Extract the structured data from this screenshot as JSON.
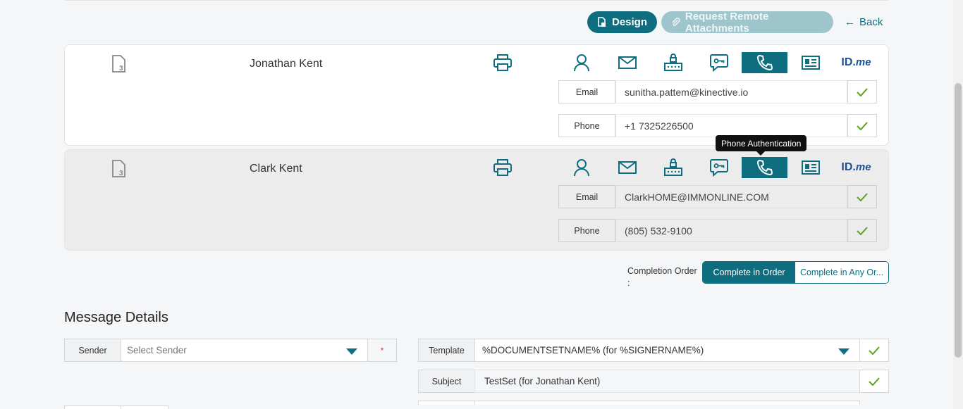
{
  "toolbar": {
    "design_label": "Design",
    "remote_label": "Request Remote Attachments",
    "back_label": "Back"
  },
  "signers": [
    {
      "name": "Jonathan Kent",
      "email_label": "Email",
      "email": "sunitha.pattem@kinective.io",
      "phone_label": "Phone",
      "phone": "+1 7325226500"
    },
    {
      "name": "Clark Kent",
      "email_label": "Email",
      "email": "ClarkHOME@IMMONLINE.COM",
      "phone_label": "Phone",
      "phone": "(805) 532-9100"
    }
  ],
  "auth_icons": [
    "person-icon",
    "mail-icon",
    "router-icon",
    "chat-key-icon",
    "phone-icon",
    "id-card-icon",
    "idme-logo"
  ],
  "idme": {
    "id": "ID.",
    "me": "me"
  },
  "tooltip": "Phone Authentication",
  "completion": {
    "label": "Completion Order :",
    "option_in_order": "Complete in Order",
    "option_any_order": "Complete in Any Or..."
  },
  "message": {
    "title": "Message Details",
    "sender_label": "Sender",
    "sender_placeholder": "Select Sender",
    "required_mark": "*",
    "template_label": "Template",
    "template_value": "%DOCUMENTSETNAME% (for %SIGNERNAME%)",
    "subject_label": "Subject",
    "subject_value": "TestSet (for Jonathan Kent)"
  },
  "colors": {
    "accent": "#0e6e80",
    "check": "#5aa31e"
  }
}
